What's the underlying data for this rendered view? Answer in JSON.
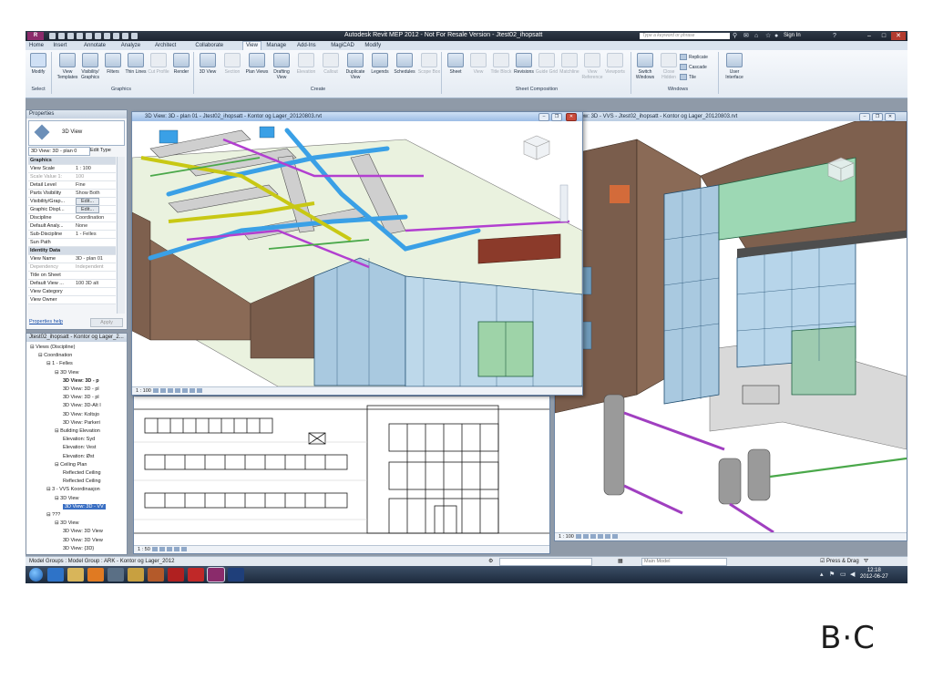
{
  "window": {
    "app_logo": "R",
    "title": "Autodesk Revit MEP 2012 - Not For Resale Version -    Jtest02_ihopsatt",
    "search_placeholder": "Type a keyword or phrase",
    "sign_in": "Sign In"
  },
  "tabs": [
    "Home",
    "Insert",
    "Annotate",
    "Analyze",
    "Architect",
    "Collaborate",
    "View",
    "Manage",
    "Add-Ins",
    "MagiCAD",
    "Modify"
  ],
  "active_tab": "View",
  "ribbon": {
    "select": {
      "modify": "Modify",
      "panel": "Select"
    },
    "graphics": {
      "buttons": [
        "View Templates",
        "Visibility/ Graphics",
        "Filters",
        "Thin Lines",
        "Cut Profile",
        "Render"
      ],
      "panel": "Graphics"
    },
    "create": {
      "buttons": [
        "3D View",
        "Section",
        "Plan Views",
        "Drafting View",
        "Elevation",
        "Callout",
        "Duplicate View",
        "Legends",
        "Schedules",
        "Scope Box"
      ],
      "panel": "Create"
    },
    "sheet": {
      "buttons": [
        "Sheet",
        "View",
        "Title Block",
        "Revisions",
        "Guide Grid",
        "Matchline",
        "View Reference",
        "Viewports"
      ],
      "panel": "Sheet Composition"
    },
    "windows": {
      "buttons": [
        "Switch Windows",
        "Close Hidden"
      ],
      "small": [
        "Replicate",
        "Cascade",
        "Tile"
      ],
      "panel": "Windows"
    },
    "ui": {
      "button": "User Interface"
    }
  },
  "properties": {
    "title": "Properties",
    "type_name": "3D View",
    "instance": "3D View: 3D - plan 0",
    "edit_type": "Edit Type",
    "rows": [
      {
        "k": "Graphics",
        "v": "",
        "group": true
      },
      {
        "k": "View Scale",
        "v": "1 : 100"
      },
      {
        "k": "Scale Value   1:",
        "v": "100",
        "dis": true
      },
      {
        "k": "Detail Level",
        "v": "Fine"
      },
      {
        "k": "Parts Visibility",
        "v": "Show Both"
      },
      {
        "k": "Visibility/Grap...",
        "v": "Edit...",
        "btn": true
      },
      {
        "k": "Graphic Displ...",
        "v": "Edit...",
        "btn": true
      },
      {
        "k": "Discipline",
        "v": "Coordination"
      },
      {
        "k": "Default Analy...",
        "v": "None"
      },
      {
        "k": "Sub-Discipline",
        "v": "1 - Felles"
      },
      {
        "k": "Sun Path",
        "v": ""
      },
      {
        "k": "Identity Data",
        "v": "",
        "group": true
      },
      {
        "k": "View Name",
        "v": "3D - plan 01"
      },
      {
        "k": "Dependency",
        "v": "Independent",
        "dis": true
      },
      {
        "k": "Title on Sheet",
        "v": ""
      },
      {
        "k": "Default View ...",
        "v": "100 3D alt"
      },
      {
        "k": "View Category",
        "v": ""
      },
      {
        "k": "View Owner",
        "v": ""
      }
    ],
    "help": "Properties help",
    "apply": "Apply"
  },
  "browser": {
    "title": "Jtest02_ihopsatt - Kontor og Lager_2...",
    "nodes": [
      {
        "t": "Views (Discipline)",
        "d": 0,
        "sign": "−"
      },
      {
        "t": "Coordination",
        "d": 1,
        "sign": "−"
      },
      {
        "t": "1 - Felles",
        "d": 2,
        "sign": "−"
      },
      {
        "t": "3D View",
        "d": 3,
        "sign": "−"
      },
      {
        "t": "3D View: 3D - p",
        "d": 4,
        "bold": true
      },
      {
        "t": "3D View: 3D - pl",
        "d": 4
      },
      {
        "t": "3D View: 3D - pl",
        "d": 4
      },
      {
        "t": "3D View: 3D-Alt I",
        "d": 4
      },
      {
        "t": "3D View: Koltsjo",
        "d": 4
      },
      {
        "t": "3D View: Parkeri",
        "d": 4
      },
      {
        "t": "Building Elevation",
        "d": 3,
        "sign": "−"
      },
      {
        "t": "Elevation: Syd",
        "d": 4
      },
      {
        "t": "Elevation: Vest",
        "d": 4
      },
      {
        "t": "Elevation: Øst",
        "d": 4
      },
      {
        "t": "Ceiling Plan",
        "d": 3,
        "sign": "−"
      },
      {
        "t": "Reflected Ceiling",
        "d": 4
      },
      {
        "t": "Reflected Ceiling",
        "d": 4
      },
      {
        "t": "3 - VVS Koordinasjon",
        "d": 2,
        "sign": "−"
      },
      {
        "t": "3D View",
        "d": 3,
        "sign": "−"
      },
      {
        "t": "3D View: 3D - VV",
        "d": 4,
        "sel": true
      },
      {
        "t": "???",
        "d": 2,
        "sign": "−"
      },
      {
        "t": "3D View",
        "d": 3,
        "sign": "−"
      },
      {
        "t": "3D View: 3D View",
        "d": 4
      },
      {
        "t": "3D View: 3D View",
        "d": 4
      },
      {
        "t": "3D View: {3D}",
        "d": 4
      }
    ]
  },
  "views": {
    "plan": {
      "title": "3D View: 3D - plan 01 - Jtest02_ihopsatt - Kontor og Lager_20120803.rvt",
      "scale": "1 : 100"
    },
    "vvs": {
      "title": "3D View: 3D - VVS - Jtest02_ihopsatt - Kontor og Lager_20120803.rvt",
      "scale": "1 : 100"
    },
    "elev": {
      "scale": "1 : 50"
    }
  },
  "status": {
    "text": "Model Groups : Model Group : ARK - Kontor og Lager_2012",
    "main_model": "Main Model",
    "press_drag": "Press & Drag"
  },
  "taskbar": {
    "time": "12:18",
    "date": "2012-06-27"
  },
  "logo": {
    "text": "B·C"
  }
}
